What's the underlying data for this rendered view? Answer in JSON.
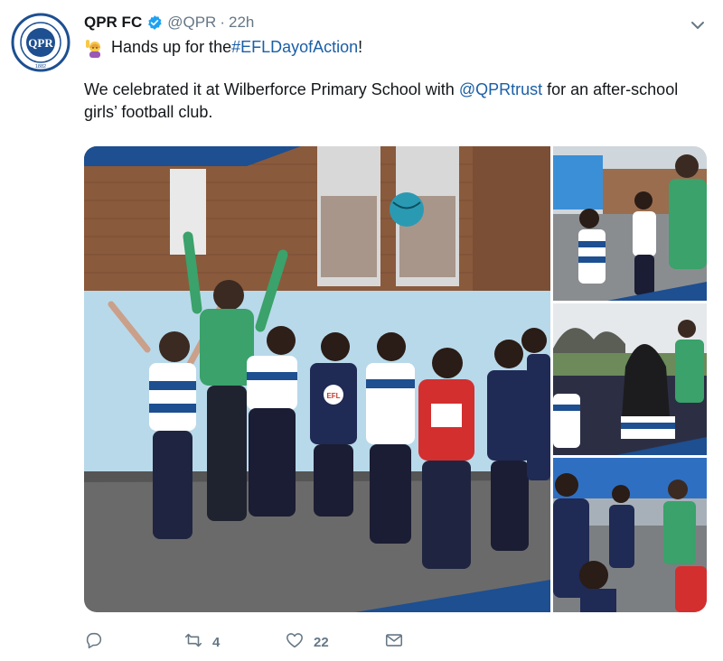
{
  "tweet": {
    "author_name": "QPR FC",
    "handle": "@QPR",
    "separator": "·",
    "time": "22h",
    "line1_prefix": "Hands up for the ",
    "line1_hashtag": "#EFLDayofAction",
    "line1_suffix": "!",
    "para_prefix": "We celebrated it at Wilberforce Primary School with ",
    "para_mention": "@QPRtrust",
    "para_suffix": " for an after-school girls’ football club.",
    "avatar_text_top": "QUEENS PARK RANGERS",
    "avatar_monogram": "QPR",
    "avatar_year": "1882"
  },
  "actions": {
    "reply_count": "",
    "retweet_count": "4",
    "like_count": "22"
  },
  "media": {
    "shirt_text": "EFL"
  },
  "colors": {
    "link": "#1b5fa7",
    "verified": "#1da1f2",
    "qpr_blue": "#1d4f91",
    "meta_gray": "#657786"
  }
}
